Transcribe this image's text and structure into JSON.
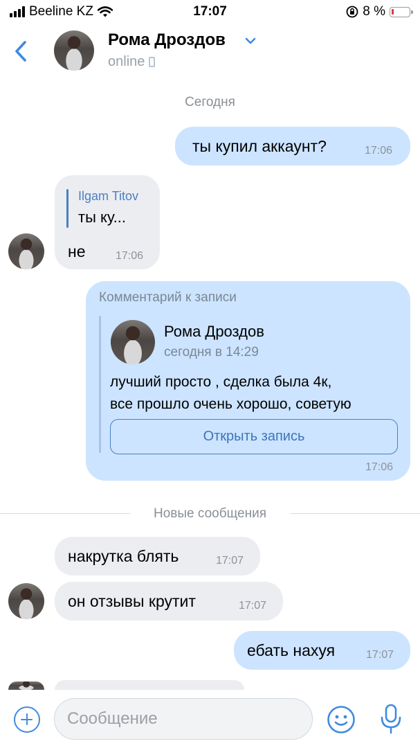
{
  "status_bar": {
    "carrier": "Beeline KZ",
    "time": "17:07",
    "battery_percent": "8 %",
    "battery_color": "#e53935"
  },
  "header": {
    "contact_name": "Рома Дроздов",
    "status": "online",
    "back_icon": "chevron-left-icon",
    "accent": "#3f8ae0"
  },
  "date_separator": "Сегодня",
  "messages": {
    "m1": {
      "text": "ты купил аккаунт?",
      "time": "17:06"
    },
    "m2": {
      "reply_author": "Ilgam Titov",
      "reply_text": "ты ку...",
      "text": "не",
      "time": "17:06"
    },
    "m3": {
      "label": "Комментарий к записи",
      "author": "Рома Дроздов",
      "date": "сегодня в 14:29",
      "text_line1": "лучший просто , сделка была 4к,",
      "text_line2": "все прошло очень хорошо, советую",
      "button": "Открыть запись",
      "time": "17:06"
    },
    "m4": {
      "text": "накрутка блять",
      "time": "17:07"
    },
    "m5": {
      "text": "он отзывы крутит",
      "time": "17:07"
    },
    "m6": {
      "text": "ебать нахуя",
      "time": "17:07"
    }
  },
  "new_messages_separator": "Новые сообщения",
  "input": {
    "placeholder": "Сообщение",
    "value": ""
  },
  "colors": {
    "outgoing_bubble": "#cce4ff",
    "incoming_bubble": "#ecedf1",
    "link": "#4a7fc1"
  }
}
